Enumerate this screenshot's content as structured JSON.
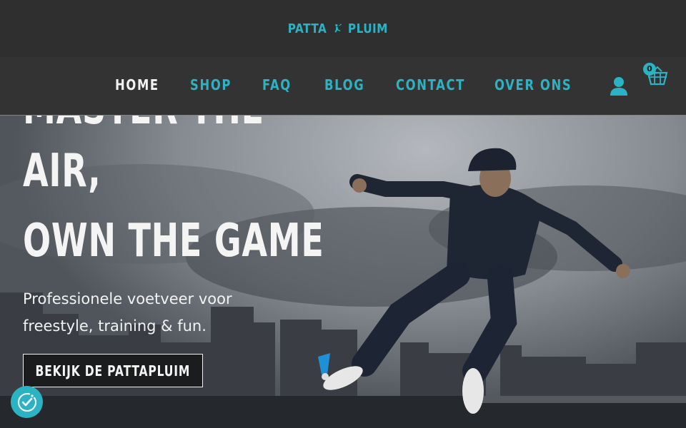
{
  "brand": {
    "logo_left": "PATTA",
    "logo_right": "PLUIM",
    "accent_color": "#2bb3c4"
  },
  "nav": {
    "items": [
      {
        "label": "HOME",
        "active": true
      },
      {
        "label": "SHOP",
        "active": false
      },
      {
        "label": "FAQ",
        "active": false
      },
      {
        "label": "BLOG",
        "active": false
      },
      {
        "label": "CONTACT",
        "active": false
      },
      {
        "label": "OVER ONS",
        "active": false
      }
    ],
    "account_icon": "user-icon",
    "cart_icon": "basket-icon",
    "cart_count": "0"
  },
  "hero": {
    "headline_lines": [
      "MASTER THE",
      "AIR,",
      "OWN THE GAME"
    ],
    "subtitle": "Professionele voetveer voor freestyle, training & fun.",
    "cta_label": "BEKIJK DE PATTAPLUIM"
  },
  "consent": {
    "icon": "cookie-consent-icon"
  }
}
